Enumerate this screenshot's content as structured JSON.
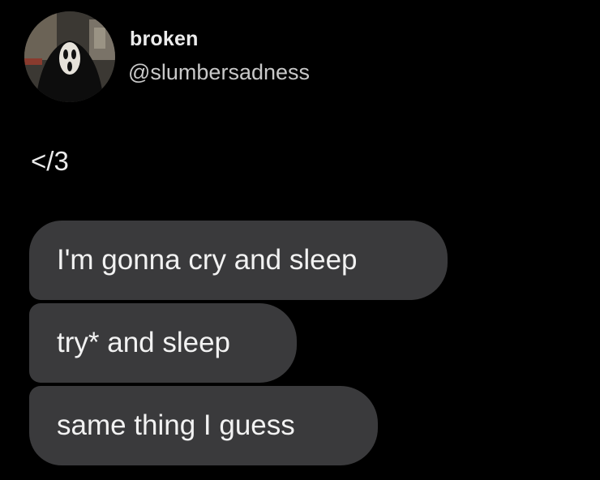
{
  "profile": {
    "display_name": "broken",
    "handle": "@slumbersadness",
    "avatar_icon": "ghostface-avatar"
  },
  "tweet": {
    "text": "</3"
  },
  "messages": [
    {
      "text": "I'm gonna cry and sleep"
    },
    {
      "text": "try* and sleep"
    },
    {
      "text": "same thing I guess"
    }
  ],
  "colors": {
    "background": "#000000",
    "bubble": "#3a3a3c",
    "text": "#ececec"
  }
}
